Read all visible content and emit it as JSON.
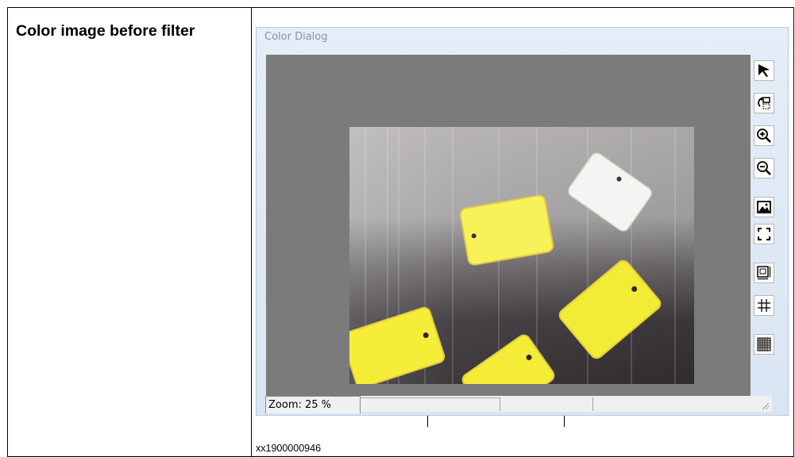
{
  "doc": {
    "caption": "Color image before filter",
    "reference_id": "xx1900000946"
  },
  "dialog": {
    "title": "Color Dialog",
    "status": {
      "zoom_text": "Zoom: 25 %"
    },
    "toolbar": [
      {
        "name": "select-arrow-icon"
      },
      {
        "name": "rotate-selection-icon"
      },
      {
        "name": "zoom-in-icon"
      },
      {
        "name": "zoom-out-icon"
      },
      {
        "name": "image-icon"
      },
      {
        "name": "fit-to-window-icon"
      },
      {
        "name": "scale-box-icon"
      },
      {
        "name": "grid-icon"
      },
      {
        "name": "fine-grid-icon"
      }
    ]
  },
  "colors": {
    "background_gray": "#7b7b7b",
    "tag_yellow": "#f2f03a",
    "window_frame": "#dae5f3"
  }
}
